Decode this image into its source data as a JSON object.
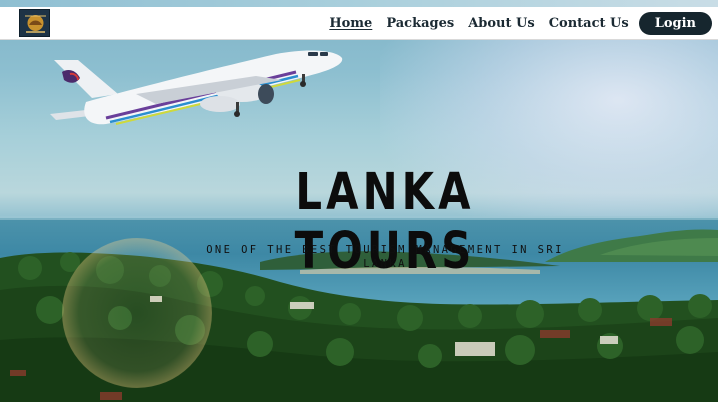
{
  "nav": {
    "logo_icon": "lanka-tours-logo",
    "links": [
      {
        "label": "Home",
        "active": true
      },
      {
        "label": "Packages",
        "active": false
      },
      {
        "label": "About Us",
        "active": false
      },
      {
        "label": "Contact Us",
        "active": false
      }
    ],
    "login_label": "Login"
  },
  "hero": {
    "title": "LANKA TOURS",
    "subtitle": "ONE OF THE BEST TOURISM MANAGEMENT IN SRI LANKA",
    "background_icon": "tropical-coast-photo",
    "plane_icon": "airplane-photo"
  },
  "colors": {
    "nav_bg": "#ffffff",
    "nav_text": "#1b2a33",
    "login_bg": "#16262e",
    "login_text": "#ffffff",
    "title_text": "#0c0c0c"
  }
}
